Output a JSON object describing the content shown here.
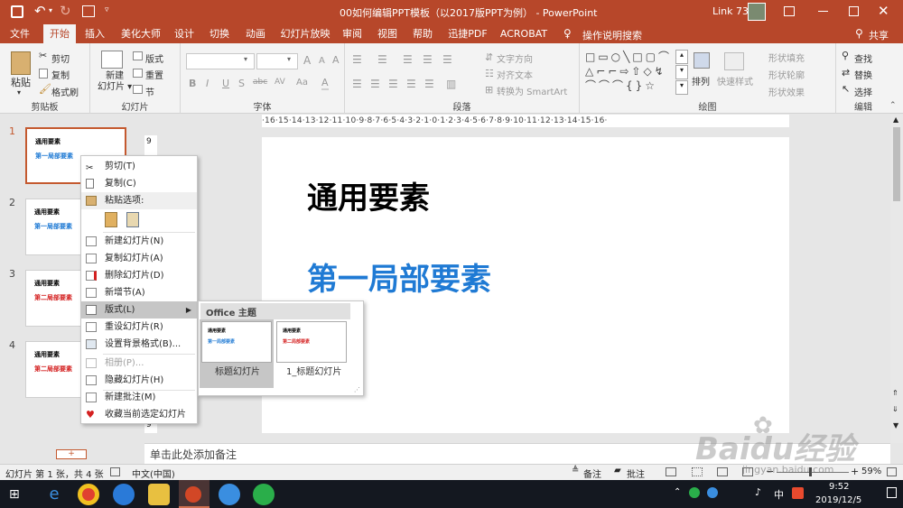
{
  "window": {
    "title": "00如何编辑PPT模板（以2017版PPT为例） - PowerPoint",
    "user": "Link 73"
  },
  "tabs": [
    "文件",
    "开始",
    "插入",
    "美化大师",
    "设计",
    "切换",
    "动画",
    "幻灯片放映",
    "审阅",
    "视图",
    "帮助",
    "迅捷PDF",
    "ACROBAT"
  ],
  "tellme": "操作说明搜索",
  "share": "共享",
  "ribbon": {
    "clipboard": {
      "label": "剪贴板",
      "paste": "粘贴",
      "cut": "剪切",
      "copy": "复制",
      "format_painter": "格式刷"
    },
    "slides": {
      "label": "幻灯片",
      "new_slide": "新建\n幻灯片",
      "layout": "版式",
      "reset": "重置",
      "section": "节"
    },
    "font": {
      "label": "字体",
      "bold": "B",
      "italic": "I",
      "underline": "U",
      "strike": "S",
      "shadow": "abc",
      "spacing": "AV",
      "aa": "Aa",
      "grow": "A",
      "shrink": "A"
    },
    "paragraph": {
      "label": "段落",
      "text_direction": "文字方向",
      "align_text": "对齐文本",
      "convert_smartart": "转换为 SmartArt"
    },
    "drawing": {
      "label": "绘图",
      "arrange": "排列",
      "quick_styles": "快速样式",
      "shape_fill": "形状填充",
      "shape_outline": "形状轮廓",
      "shape_effects": "形状效果"
    },
    "editing": {
      "label": "编辑",
      "find": "查找",
      "replace": "替换",
      "select": "选择"
    }
  },
  "thumbnails": [
    {
      "num": "1",
      "title": "通用要素",
      "sub": "第一局部要素",
      "color": "#1f7ad4"
    },
    {
      "num": "2",
      "title": "通用要素",
      "sub": "第一局部要素",
      "color": "#1f7ad4"
    },
    {
      "num": "3",
      "title": "通用要素",
      "sub": "第二局部要素",
      "color": "#d42020"
    },
    {
      "num": "4",
      "title": "通用要素",
      "sub": "第二局部要素",
      "color": "#d42020"
    }
  ],
  "ruler_h": "·16·15·14·13·12·11·10·9·8·7·6·5·4·3·2·1·0·1·2·3·4·5·6·7·8·9·10·11·12·13·14·15·16·",
  "ruler_v": {
    "top": "9",
    "bottom": "9"
  },
  "slide": {
    "title": "通用要素",
    "subtitle": "第一局部要素",
    "subtitle_color": "#1f7ad4"
  },
  "context_menu": {
    "cut": "剪切(T)",
    "copy": "复制(C)",
    "paste_options": "粘贴选项:",
    "new_slide": "新建幻灯片(N)",
    "dup_slide": "复制幻灯片(A)",
    "del_slide": "删除幻灯片(D)",
    "add_section": "新增节(A)",
    "layout": "版式(L)",
    "reset_slide": "重设幻灯片(R)",
    "format_bg": "设置背景格式(B)...",
    "photo_album": "相册(P)...",
    "hide_slide": "隐藏幻灯片(H)",
    "new_comment": "新建批注(M)",
    "favorite": "收藏当前选定幻灯片"
  },
  "layout_submenu": {
    "header": "Office 主题",
    "items": [
      {
        "label": "标题幻灯片",
        "t": "通用要素",
        "s": "第一局部要素",
        "color": "#1f7ad4"
      },
      {
        "label": "1_标题幻灯片",
        "t": "通用要素",
        "s": "第二局部要素",
        "color": "#d42020"
      }
    ]
  },
  "notes_placeholder": "单击此处添加备注",
  "status": {
    "slide_info": "幻灯片 第 1 张，共 4 张",
    "language": "中文(中国)",
    "notes": "备注",
    "comments": "批注",
    "zoom": "59%"
  },
  "taskbar": {
    "time": "9:52",
    "date": "2019/12/5",
    "ime": "中"
  },
  "watermark": {
    "brand": "Baidu经验",
    "url": "jingyan.baidu.com"
  }
}
